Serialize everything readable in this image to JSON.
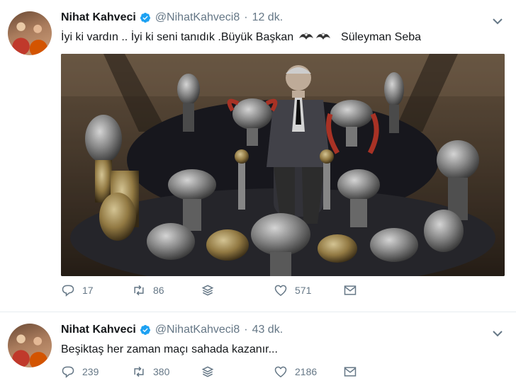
{
  "tweets": [
    {
      "name": "Nihat Kahveci",
      "handle": "@NihatKahveci8",
      "separator": "·",
      "time": "12 dk.",
      "text": "İyi ki vardın .. İyi ki seni tanıdık .Büyük Başkan",
      "text_suffix": "Süleyman Seba",
      "replies": "17",
      "retweets": "86",
      "likes": "571"
    },
    {
      "name": "Nihat Kahveci",
      "handle": "@NihatKahveci8",
      "separator": "·",
      "time": "43 dk.",
      "text": "Beşiktaş her zaman maçı sahada kazanır...",
      "replies": "239",
      "retweets": "380",
      "likes": "2186"
    }
  ],
  "icons": {
    "verified": "verified-badge-icon",
    "caret": "chevron-down-icon",
    "reply": "reply-icon",
    "retweet": "retweet-icon",
    "stack": "stack-icon",
    "like": "heart-icon",
    "dm": "envelope-icon",
    "emoji": "eagle-emoji-icon"
  },
  "colors": {
    "verified": "#1da1f2",
    "muted": "#657786",
    "text": "#14171a",
    "border": "#e6ecf0"
  }
}
